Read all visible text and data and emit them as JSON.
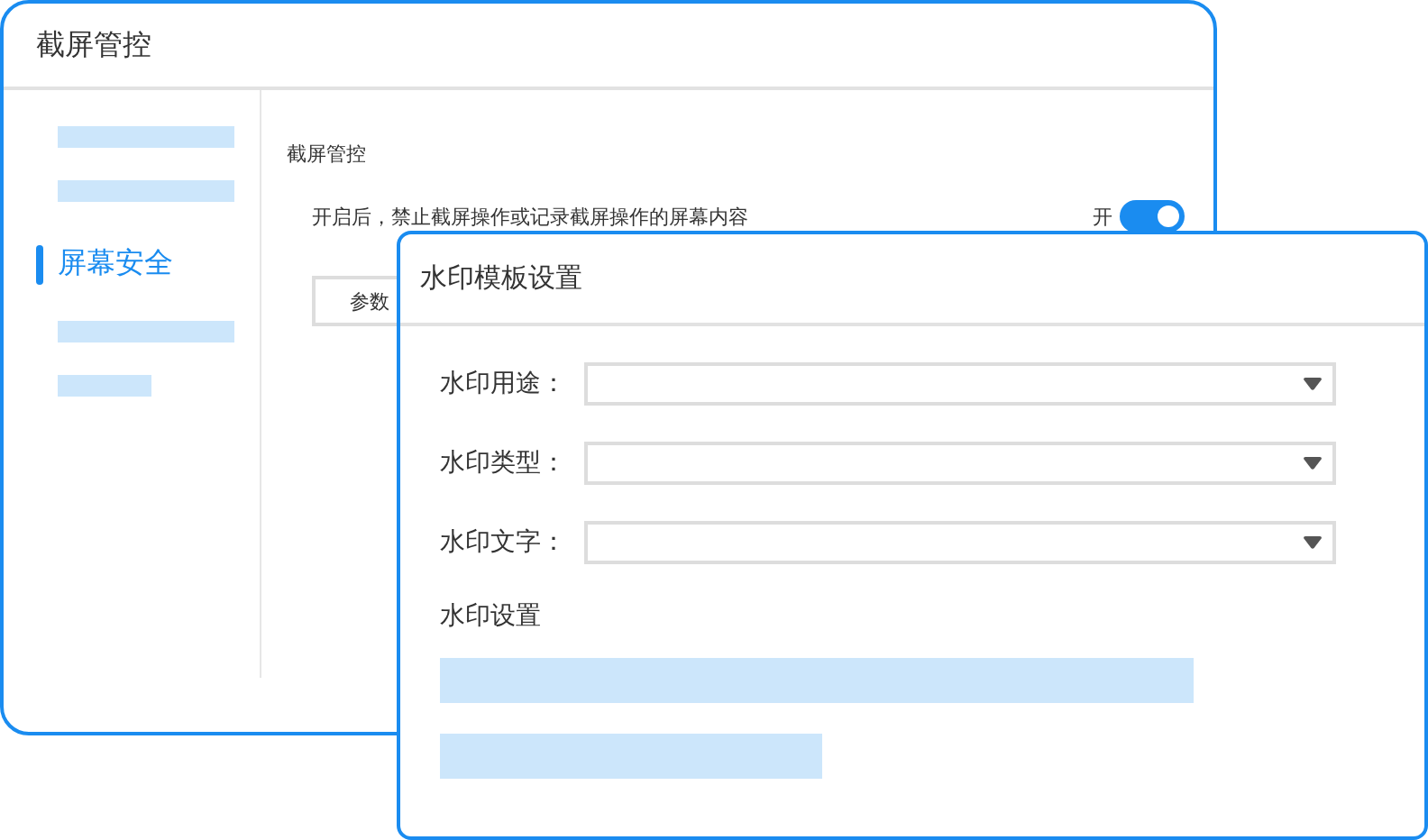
{
  "window": {
    "title": "截屏管控"
  },
  "sidebar": {
    "items": [
      {
        "kind": "bar",
        "selected": false
      },
      {
        "kind": "bar",
        "selected": false
      },
      {
        "kind": "label",
        "label": "屏幕安全",
        "selected": true
      },
      {
        "kind": "bar",
        "selected": false
      },
      {
        "kind": "short-bar",
        "selected": false
      }
    ]
  },
  "content": {
    "section_title": "截屏管控",
    "description": "开启后，禁止截屏操作或记录截屏操作的屏幕内容",
    "toggle": {
      "label": "开",
      "on": true
    },
    "button": "参数"
  },
  "dialog": {
    "title": "水印模板设置",
    "fields": [
      {
        "label": "水印用途："
      },
      {
        "label": "水印类型："
      },
      {
        "label": "水印文字："
      }
    ],
    "section_title": "水印设置",
    "bars": [
      {
        "kind": "long-bar"
      },
      {
        "kind": "short-bar"
      }
    ]
  }
}
